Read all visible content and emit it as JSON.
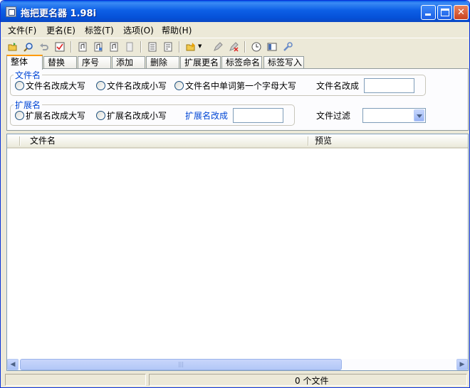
{
  "window": {
    "title": "拖把更名器 1.98i"
  },
  "menu": [
    "文件(F)",
    "更名(E)",
    "标签(T)",
    "选项(O)",
    "帮助(H)"
  ],
  "toolbar": {
    "icons": [
      "open-folder-icon",
      "search-icon",
      "undo-icon",
      "check-icon",
      "music-tag-icon",
      "music-tag-edit-icon",
      "music-tag-read-icon",
      "page-icon",
      "list-icon",
      "list-edit-icon",
      "folder-dropdown-icon",
      "pencil-icon",
      "clear-icon",
      "clock-icon",
      "window-icon",
      "tools-icon"
    ]
  },
  "tabs": [
    "整体",
    "替换",
    "序号",
    "添加",
    "删除",
    "扩展更名",
    "标签命名",
    "标签写入"
  ],
  "filename_group": {
    "legend": "文件名",
    "options": [
      "文件名改成大写",
      "文件名改成小写",
      "文件名中单词第一个字母大写"
    ],
    "rename_label": "文件名改成",
    "rename_value": ""
  },
  "extension_group": {
    "legend": "扩展名",
    "options": [
      "扩展名改成大写",
      "扩展名改成小写"
    ],
    "rename_label": "扩展名改成",
    "rename_value": ""
  },
  "filter": {
    "label": "文件过滤",
    "selected": ""
  },
  "list": {
    "columns": [
      "文件名",
      "预览"
    ]
  },
  "status": {
    "count_text": "0 个文件"
  },
  "colors": {
    "titlebar": "#0a5ee8",
    "accent_blue": "#0046d5",
    "tab_highlight": "#ff9a00"
  }
}
